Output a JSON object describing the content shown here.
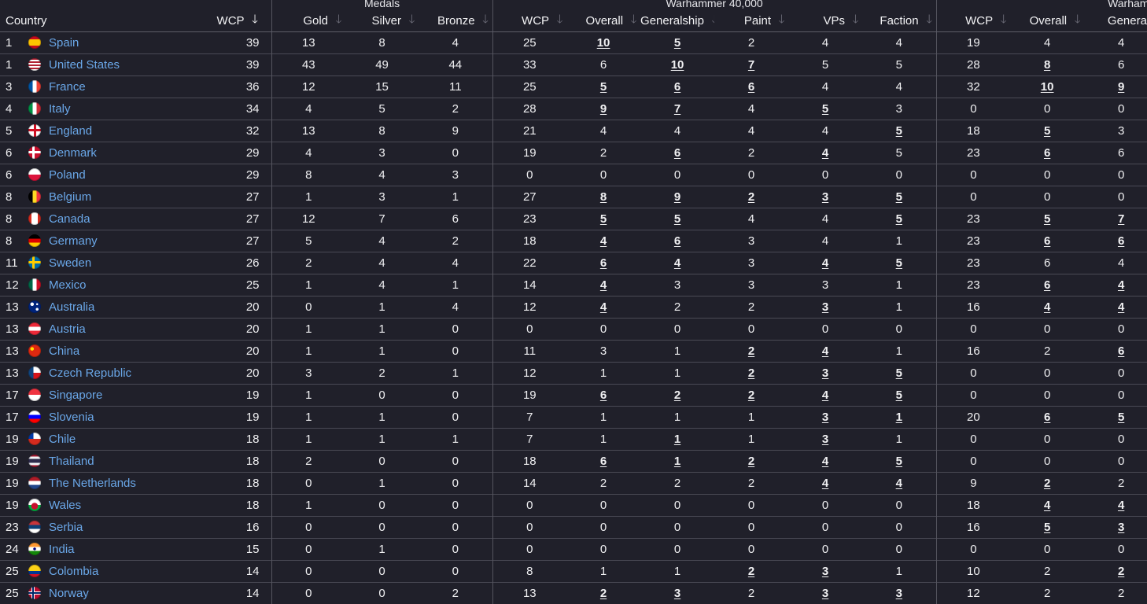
{
  "groups": {
    "medals": "Medals",
    "warhammer": "Warhammer 40,000",
    "warhammer_cut": "Warhamm"
  },
  "headers": {
    "country": "Country",
    "wcp": "WCP",
    "gold": "Gold",
    "silver": "Silver",
    "bronze": "Bronze",
    "wcp2": "WCP",
    "overall": "Overall",
    "generalship": "Generalship",
    "paint": "Paint",
    "vps": "VPs",
    "faction": "Faction",
    "wcp3": "WCP",
    "overall3": "Overall",
    "generalship3": "Generalsl"
  },
  "icons": {
    "sort_active": "arrow-down-icon",
    "sort_inactive": "arrow-down-icon"
  },
  "colors": {
    "background": "#20202a",
    "link": "#6aa7e8"
  },
  "rows": [
    {
      "rank": "1",
      "country": "Spain",
      "flag": "spain",
      "wcp": "39",
      "gold": "13",
      "silver": "8",
      "bronze": "4",
      "wcp2": "25",
      "overall": "10",
      "generalship": "5",
      "paint": "2",
      "vps": "4",
      "faction": "4",
      "wcp3": "19",
      "overall3": "4",
      "gen3": "4",
      "hl": [
        "overall",
        "generalship"
      ]
    },
    {
      "rank": "1",
      "country": "United States",
      "flag": "usa",
      "wcp": "39",
      "gold": "43",
      "silver": "49",
      "bronze": "44",
      "wcp2": "33",
      "overall": "6",
      "generalship": "10",
      "paint": "7",
      "vps": "5",
      "faction": "5",
      "wcp3": "28",
      "overall3": "8",
      "gen3": "6",
      "hl": [
        "generalship",
        "paint",
        "overall3"
      ]
    },
    {
      "rank": "3",
      "country": "France",
      "flag": "france",
      "wcp": "36",
      "gold": "12",
      "silver": "15",
      "bronze": "11",
      "wcp2": "25",
      "overall": "5",
      "generalship": "6",
      "paint": "6",
      "vps": "4",
      "faction": "4",
      "wcp3": "32",
      "overall3": "10",
      "gen3": "9",
      "hl": [
        "overall",
        "generalship",
        "paint",
        "overall3",
        "gen3"
      ]
    },
    {
      "rank": "4",
      "country": "Italy",
      "flag": "italy",
      "wcp": "34",
      "gold": "4",
      "silver": "5",
      "bronze": "2",
      "wcp2": "28",
      "overall": "9",
      "generalship": "7",
      "paint": "4",
      "vps": "5",
      "faction": "3",
      "wcp3": "0",
      "overall3": "0",
      "gen3": "0",
      "hl": [
        "overall",
        "generalship",
        "vps"
      ]
    },
    {
      "rank": "5",
      "country": "England",
      "flag": "england",
      "wcp": "32",
      "gold": "13",
      "silver": "8",
      "bronze": "9",
      "wcp2": "21",
      "overall": "4",
      "generalship": "4",
      "paint": "4",
      "vps": "4",
      "faction": "5",
      "wcp3": "18",
      "overall3": "5",
      "gen3": "3",
      "hl": [
        "faction",
        "overall3"
      ]
    },
    {
      "rank": "6",
      "country": "Denmark",
      "flag": "denmark",
      "wcp": "29",
      "gold": "4",
      "silver": "3",
      "bronze": "0",
      "wcp2": "19",
      "overall": "2",
      "generalship": "6",
      "paint": "2",
      "vps": "4",
      "faction": "5",
      "wcp3": "23",
      "overall3": "6",
      "gen3": "6",
      "hl": [
        "generalship",
        "vps",
        "overall3"
      ]
    },
    {
      "rank": "6",
      "country": "Poland",
      "flag": "poland",
      "wcp": "29",
      "gold": "8",
      "silver": "4",
      "bronze": "3",
      "wcp2": "0",
      "overall": "0",
      "generalship": "0",
      "paint": "0",
      "vps": "0",
      "faction": "0",
      "wcp3": "0",
      "overall3": "0",
      "gen3": "0",
      "hl": []
    },
    {
      "rank": "8",
      "country": "Belgium",
      "flag": "belgium",
      "wcp": "27",
      "gold": "1",
      "silver": "3",
      "bronze": "1",
      "wcp2": "27",
      "overall": "8",
      "generalship": "9",
      "paint": "2",
      "vps": "3",
      "faction": "5",
      "wcp3": "0",
      "overall3": "0",
      "gen3": "0",
      "hl": [
        "overall",
        "generalship",
        "paint",
        "vps",
        "faction"
      ]
    },
    {
      "rank": "8",
      "country": "Canada",
      "flag": "canada",
      "wcp": "27",
      "gold": "12",
      "silver": "7",
      "bronze": "6",
      "wcp2": "23",
      "overall": "5",
      "generalship": "5",
      "paint": "4",
      "vps": "4",
      "faction": "5",
      "wcp3": "23",
      "overall3": "5",
      "gen3": "7",
      "hl": [
        "overall",
        "generalship",
        "faction",
        "overall3",
        "gen3"
      ]
    },
    {
      "rank": "8",
      "country": "Germany",
      "flag": "germany",
      "wcp": "27",
      "gold": "5",
      "silver": "4",
      "bronze": "2",
      "wcp2": "18",
      "overall": "4",
      "generalship": "6",
      "paint": "3",
      "vps": "4",
      "faction": "1",
      "wcp3": "23",
      "overall3": "6",
      "gen3": "6",
      "hl": [
        "overall",
        "generalship",
        "overall3",
        "gen3"
      ]
    },
    {
      "rank": "11",
      "country": "Sweden",
      "flag": "sweden",
      "wcp": "26",
      "gold": "2",
      "silver": "4",
      "bronze": "4",
      "wcp2": "22",
      "overall": "6",
      "generalship": "4",
      "paint": "3",
      "vps": "4",
      "faction": "5",
      "wcp3": "23",
      "overall3": "6",
      "gen3": "4",
      "hl": [
        "overall",
        "generalship",
        "vps",
        "faction"
      ]
    },
    {
      "rank": "12",
      "country": "Mexico",
      "flag": "mexico",
      "wcp": "25",
      "gold": "1",
      "silver": "4",
      "bronze": "1",
      "wcp2": "14",
      "overall": "4",
      "generalship": "3",
      "paint": "3",
      "vps": "3",
      "faction": "1",
      "wcp3": "23",
      "overall3": "6",
      "gen3": "4",
      "hl": [
        "overall",
        "overall3",
        "gen3"
      ]
    },
    {
      "rank": "13",
      "country": "Australia",
      "flag": "australia",
      "wcp": "20",
      "gold": "0",
      "silver": "1",
      "bronze": "4",
      "wcp2": "12",
      "overall": "4",
      "generalship": "2",
      "paint": "2",
      "vps": "3",
      "faction": "1",
      "wcp3": "16",
      "overall3": "4",
      "gen3": "4",
      "hl": [
        "overall",
        "vps",
        "overall3",
        "gen3"
      ]
    },
    {
      "rank": "13",
      "country": "Austria",
      "flag": "austria",
      "wcp": "20",
      "gold": "1",
      "silver": "1",
      "bronze": "0",
      "wcp2": "0",
      "overall": "0",
      "generalship": "0",
      "paint": "0",
      "vps": "0",
      "faction": "0",
      "wcp3": "0",
      "overall3": "0",
      "gen3": "0",
      "hl": []
    },
    {
      "rank": "13",
      "country": "China",
      "flag": "china",
      "wcp": "20",
      "gold": "1",
      "silver": "1",
      "bronze": "0",
      "wcp2": "11",
      "overall": "3",
      "generalship": "1",
      "paint": "2",
      "vps": "4",
      "faction": "1",
      "wcp3": "16",
      "overall3": "2",
      "gen3": "6",
      "hl": [
        "paint",
        "vps",
        "gen3"
      ]
    },
    {
      "rank": "13",
      "country": "Czech Republic",
      "flag": "czech",
      "wcp": "20",
      "gold": "3",
      "silver": "2",
      "bronze": "1",
      "wcp2": "12",
      "overall": "1",
      "generalship": "1",
      "paint": "2",
      "vps": "3",
      "faction": "5",
      "wcp3": "0",
      "overall3": "0",
      "gen3": "0",
      "hl": [
        "paint",
        "vps",
        "faction"
      ]
    },
    {
      "rank": "17",
      "country": "Singapore",
      "flag": "singapore",
      "wcp": "19",
      "gold": "1",
      "silver": "0",
      "bronze": "0",
      "wcp2": "19",
      "overall": "6",
      "generalship": "2",
      "paint": "2",
      "vps": "4",
      "faction": "5",
      "wcp3": "0",
      "overall3": "0",
      "gen3": "0",
      "hl": [
        "overall",
        "generalship",
        "paint",
        "vps",
        "faction"
      ]
    },
    {
      "rank": "17",
      "country": "Slovenia",
      "flag": "slovenia",
      "wcp": "19",
      "gold": "1",
      "silver": "1",
      "bronze": "0",
      "wcp2": "7",
      "overall": "1",
      "generalship": "1",
      "paint": "1",
      "vps": "3",
      "faction": "1",
      "wcp3": "20",
      "overall3": "6",
      "gen3": "5",
      "hl": [
        "vps",
        "faction",
        "overall3",
        "gen3"
      ]
    },
    {
      "rank": "19",
      "country": "Chile",
      "flag": "chile",
      "wcp": "18",
      "gold": "1",
      "silver": "1",
      "bronze": "1",
      "wcp2": "7",
      "overall": "1",
      "generalship": "1",
      "paint": "1",
      "vps": "3",
      "faction": "1",
      "wcp3": "0",
      "overall3": "0",
      "gen3": "0",
      "hl": [
        "generalship",
        "vps"
      ]
    },
    {
      "rank": "19",
      "country": "Thailand",
      "flag": "thailand",
      "wcp": "18",
      "gold": "2",
      "silver": "0",
      "bronze": "0",
      "wcp2": "18",
      "overall": "6",
      "generalship": "1",
      "paint": "2",
      "vps": "4",
      "faction": "5",
      "wcp3": "0",
      "overall3": "0",
      "gen3": "0",
      "hl": [
        "overall",
        "generalship",
        "paint",
        "vps",
        "faction"
      ]
    },
    {
      "rank": "19",
      "country": "The Netherlands",
      "flag": "netherlands",
      "wcp": "18",
      "gold": "0",
      "silver": "1",
      "bronze": "0",
      "wcp2": "14",
      "overall": "2",
      "generalship": "2",
      "paint": "2",
      "vps": "4",
      "faction": "4",
      "wcp3": "9",
      "overall3": "2",
      "gen3": "2",
      "hl": [
        "vps",
        "faction",
        "overall3"
      ]
    },
    {
      "rank": "19",
      "country": "Wales",
      "flag": "wales",
      "wcp": "18",
      "gold": "1",
      "silver": "0",
      "bronze": "0",
      "wcp2": "0",
      "overall": "0",
      "generalship": "0",
      "paint": "0",
      "vps": "0",
      "faction": "0",
      "wcp3": "18",
      "overall3": "4",
      "gen3": "4",
      "hl": [
        "overall3",
        "gen3"
      ]
    },
    {
      "rank": "23",
      "country": "Serbia",
      "flag": "serbia",
      "wcp": "16",
      "gold": "0",
      "silver": "0",
      "bronze": "0",
      "wcp2": "0",
      "overall": "0",
      "generalship": "0",
      "paint": "0",
      "vps": "0",
      "faction": "0",
      "wcp3": "16",
      "overall3": "5",
      "gen3": "3",
      "hl": [
        "overall3",
        "gen3"
      ]
    },
    {
      "rank": "24",
      "country": "India",
      "flag": "india",
      "wcp": "15",
      "gold": "0",
      "silver": "1",
      "bronze": "0",
      "wcp2": "0",
      "overall": "0",
      "generalship": "0",
      "paint": "0",
      "vps": "0",
      "faction": "0",
      "wcp3": "0",
      "overall3": "0",
      "gen3": "0",
      "hl": []
    },
    {
      "rank": "25",
      "country": "Colombia",
      "flag": "colombia",
      "wcp": "14",
      "gold": "0",
      "silver": "0",
      "bronze": "0",
      "wcp2": "8",
      "overall": "1",
      "generalship": "1",
      "paint": "2",
      "vps": "3",
      "faction": "1",
      "wcp3": "10",
      "overall3": "2",
      "gen3": "2",
      "hl": [
        "paint",
        "vps",
        "gen3"
      ]
    },
    {
      "rank": "25",
      "country": "Norway",
      "flag": "norway",
      "wcp": "14",
      "gold": "0",
      "silver": "0",
      "bronze": "2",
      "wcp2": "13",
      "overall": "2",
      "generalship": "3",
      "paint": "2",
      "vps": "3",
      "faction": "3",
      "wcp3": "12",
      "overall3": "2",
      "gen3": "2",
      "hl": [
        "overall",
        "generalship",
        "vps",
        "faction"
      ]
    }
  ]
}
